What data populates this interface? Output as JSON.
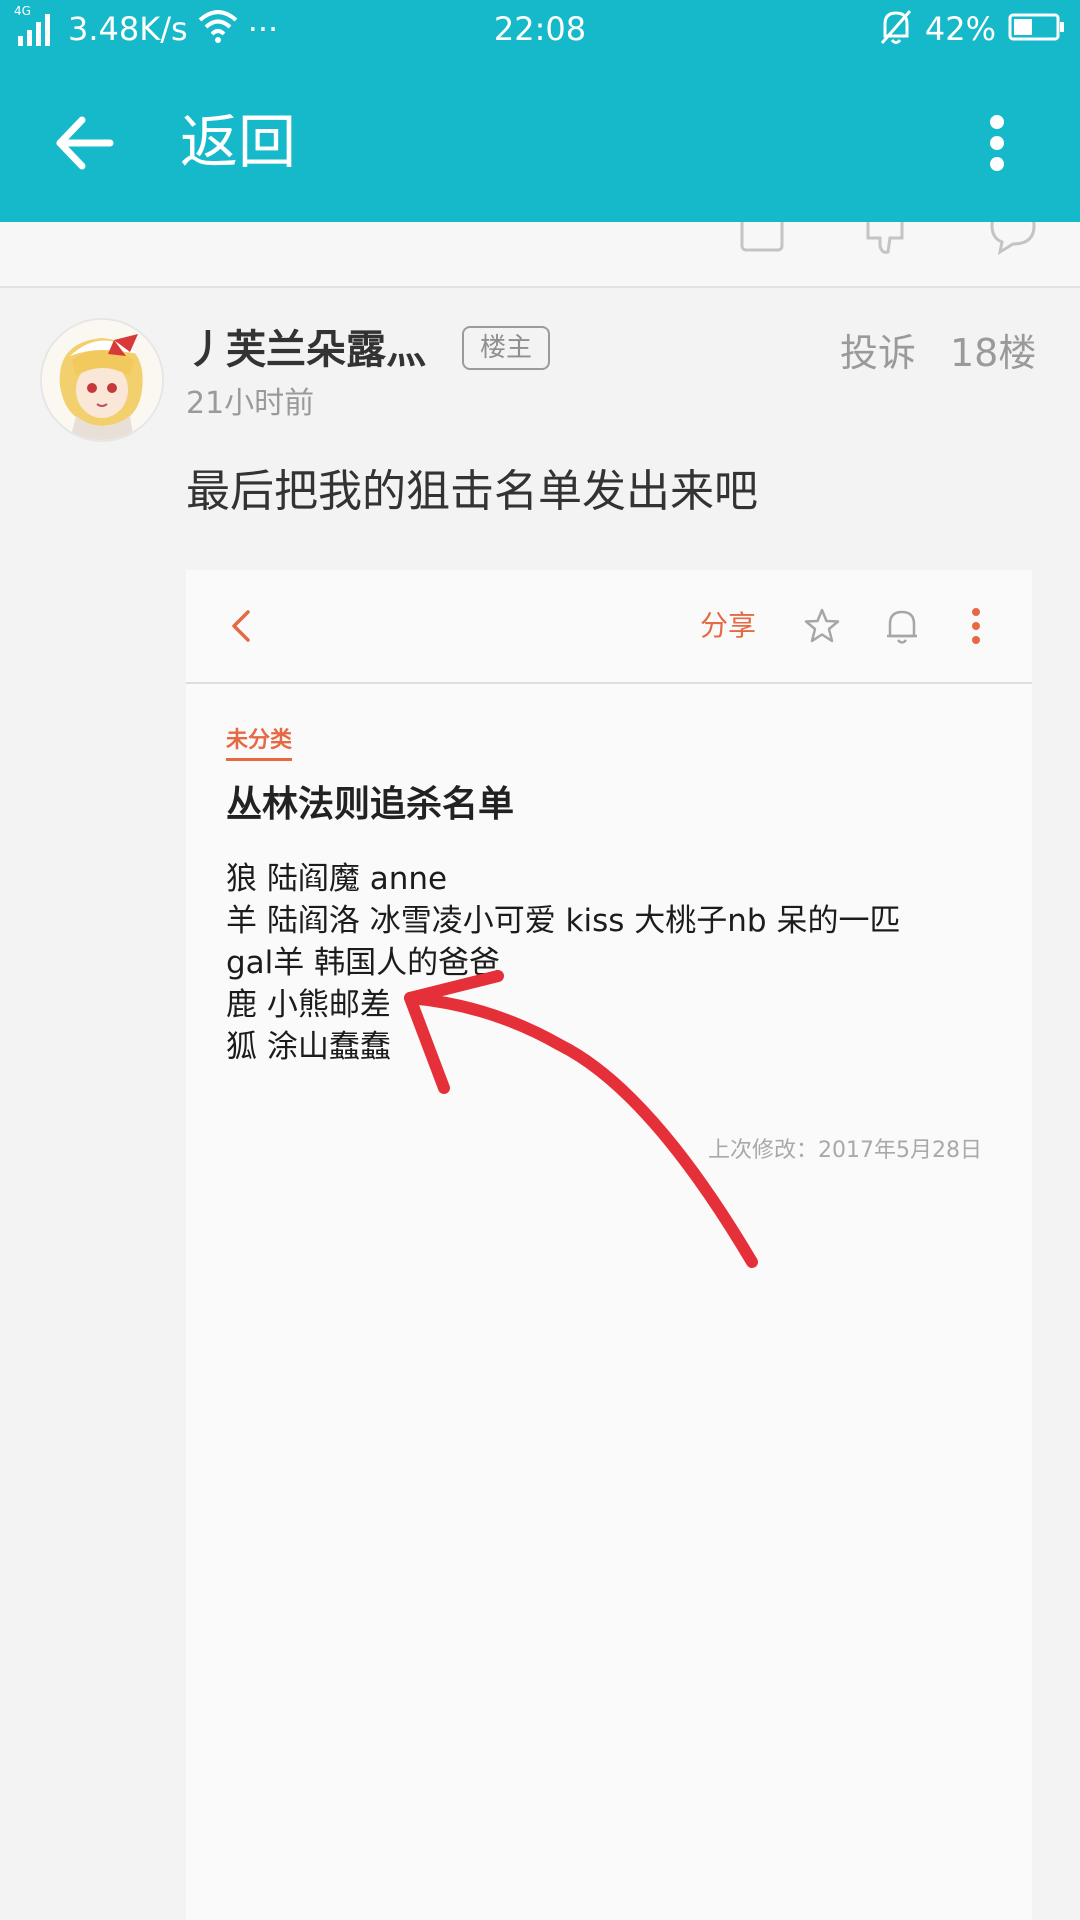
{
  "status_bar": {
    "network": "4G",
    "speed": "3.48K/s",
    "more": "···",
    "time": "22:08",
    "battery": "42%",
    "icons": [
      "signal-icon",
      "wifi-icon",
      "mute-bell-icon",
      "battery-icon"
    ]
  },
  "app_bar": {
    "title": "返回",
    "back_icon": "arrow-left-icon",
    "more_icon": "more-vertical-icon",
    "color": "#16b9c9"
  },
  "previous_floor_actions": [
    "share-icon",
    "thumbs-down-icon",
    "comment-icon"
  ],
  "post": {
    "username": "丿芙兰朵露灬",
    "badge": "楼主",
    "report": "投诉",
    "floor": "18楼",
    "time": "21小时前",
    "body": "最后把我的狙击名单发出来吧"
  },
  "note_screenshot": {
    "share": "分享",
    "category": "未分类",
    "title": "丛林法则追杀名单",
    "lines": [
      "狼 陆阎魔 anne",
      "羊 陆阎洛 冰雪凌小可爱 kiss 大桃子nb 呆的一匹",
      "gal羊 韩国人的爸爸",
      "鹿 小熊邮差",
      "狐 涂山蠢蠢"
    ],
    "last_modified": "上次修改：2017年5月28日",
    "accent_color": "#e56a43"
  },
  "annotation": {
    "color": "#e5303a",
    "shape": "hand-drawn arrow pointing at 鹿 小熊邮差"
  }
}
